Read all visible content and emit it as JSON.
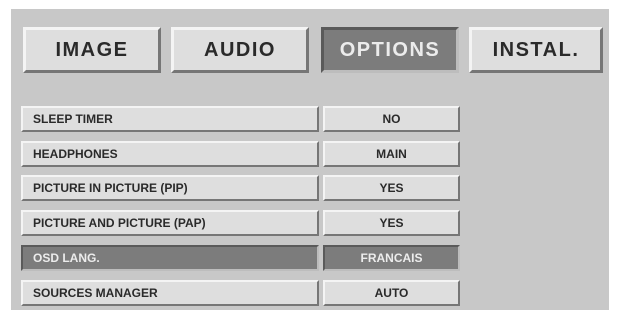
{
  "tabs": [
    {
      "label": "IMAGE"
    },
    {
      "label": "AUDIO"
    },
    {
      "label": "OPTIONS"
    },
    {
      "label": "INSTAL."
    }
  ],
  "active_tab": "OPTIONS",
  "rows": [
    {
      "label": "SLEEP TIMER",
      "value": "NO"
    },
    {
      "label": "HEADPHONES",
      "value": "MAIN"
    },
    {
      "label": "PICTURE IN PICTURE (PIP)",
      "value": "YES"
    },
    {
      "label": "PICTURE AND PICTURE (PAP)",
      "value": "YES"
    },
    {
      "label": "OSD LANG.",
      "value": "FRANCAIS"
    },
    {
      "label": "SOURCES MANAGER",
      "value": "AUTO"
    }
  ],
  "selected_row": "OSD LANG.",
  "colors": {
    "panel": "#c8c8c8",
    "button_face": "#dedede",
    "selected_face": "#7c7c7c",
    "text": "#2a2a2a",
    "selected_text": "#ececec"
  }
}
